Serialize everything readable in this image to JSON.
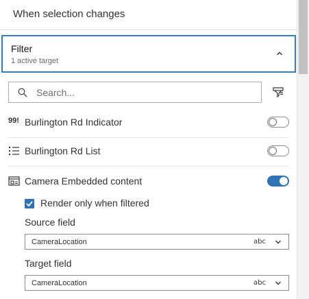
{
  "header": {
    "title": "When selection changes"
  },
  "filter": {
    "title": "Filter",
    "subtitle": "1 active target"
  },
  "search": {
    "placeholder": "Search..."
  },
  "targets": [
    {
      "icon": "99!",
      "label": "Burlington Rd Indicator",
      "enabled": false
    },
    {
      "icon": "list-icon",
      "label": "Burlington Rd List",
      "enabled": false
    },
    {
      "icon": "embed-icon",
      "label": "Camera Embedded content",
      "enabled": true
    }
  ],
  "options": {
    "render_only_filtered": {
      "label": "Render only when filtered",
      "checked": true
    },
    "source_field": {
      "label": "Source field",
      "value": "CameraLocation",
      "type_badge": "abc"
    },
    "target_field": {
      "label": "Target field",
      "value": "CameraLocation",
      "type_badge": "abc"
    }
  },
  "colors": {
    "accent": "#2f73b4",
    "focus_border": "#2f7fc1"
  }
}
